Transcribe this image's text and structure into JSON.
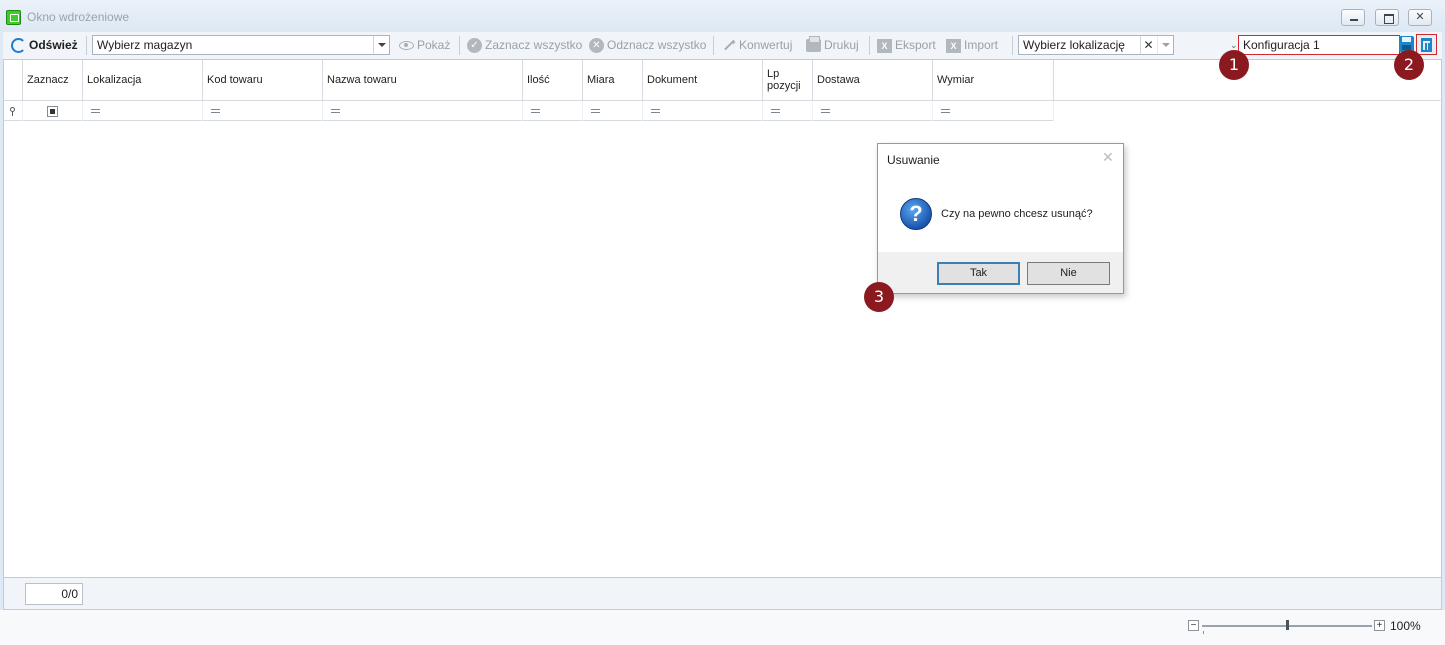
{
  "window": {
    "title": "Okno wdrożeniowe"
  },
  "toolbar": {
    "refresh_label": "Odśwież",
    "warehouse_placeholder": "Wybierz magazyn",
    "show_label": "Pokaż",
    "select_all_label": "Zaznacz wszystko",
    "deselect_all_label": "Odznacz wszystko",
    "convert_label": "Konwertuj",
    "print_label": "Drukuj",
    "export_label": "Eksport",
    "import_label": "Import",
    "location_placeholder": "Wybierz lokalizację",
    "location_clear": "✕",
    "configuration_value": "Konfiguracja 1"
  },
  "grid": {
    "columns": [
      "Zaznacz",
      "Lokalizacja",
      "Kod towaru",
      "Nazwa towaru",
      "Ilość",
      "Miara",
      "Dokument",
      "Lp pozycji",
      "Dostawa",
      "Wymiar"
    ],
    "lp_line1": "Lp",
    "lp_line2": "pozycji"
  },
  "footer": {
    "record_counter": "0/0"
  },
  "status": {
    "zoom_minus": "−",
    "zoom_plus": "+",
    "zoom_percent": "100%",
    "zoom_level": 0.5
  },
  "dialog": {
    "title": "Usuwanie",
    "close_glyph": "✕",
    "icon": "?",
    "message": "Czy na pewno chcesz usunąć?",
    "yes_label": "Tak",
    "no_label": "Nie"
  },
  "markers": {
    "m1": "1",
    "m2": "2",
    "m3": "3"
  },
  "colors": {
    "highlight_border": "#d3282e",
    "marker_bg": "#8b1a20",
    "accent_blue": "#1a7ed6"
  }
}
